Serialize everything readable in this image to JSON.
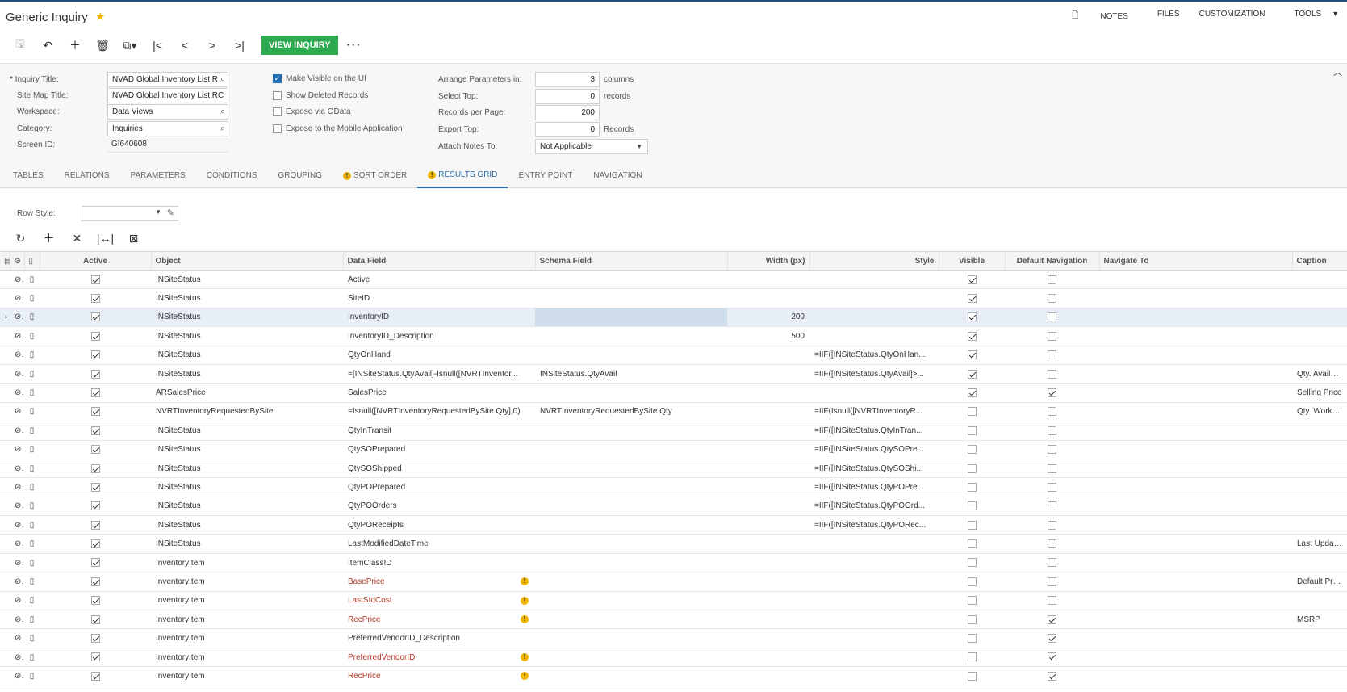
{
  "header": {
    "title": "Generic Inquiry",
    "nav": [
      "NOTES",
      "FILES",
      "CUSTOMIZATION",
      "TOOLS"
    ]
  },
  "toolbar": {
    "view_inquiry": "VIEW INQUIRY",
    "more": "···"
  },
  "form": {
    "inquiry_title_label": "Inquiry Title:",
    "inquiry_title": "NVAD Global Inventory List R",
    "site_map_title_label": "Site Map Title:",
    "site_map_title": "NVAD Global Inventory List RC",
    "workspace_label": "Workspace:",
    "workspace": "Data Views",
    "category_label": "Category:",
    "category": "Inquiries",
    "screen_id_label": "Screen ID:",
    "screen_id": "GI640608",
    "make_visible": "Make Visible on the UI",
    "show_deleted": "Show Deleted Records",
    "expose_odata": "Expose via OData",
    "expose_mobile": "Expose to the Mobile Application",
    "arrange_label": "Arrange Parameters in:",
    "arrange_value": "3",
    "arrange_unit": "columns",
    "select_top_label": "Select Top:",
    "select_top_value": "0",
    "select_top_unit": "records",
    "records_per_page_label": "Records per Page:",
    "records_per_page_value": "200",
    "export_top_label": "Export Top:",
    "export_top_value": "0",
    "export_top_unit": "Records",
    "attach_notes_label": "Attach Notes To:",
    "attach_notes_value": "Not Applicable"
  },
  "tabs": [
    "TABLES",
    "RELATIONS",
    "PARAMETERS",
    "CONDITIONS",
    "GROUPING",
    "SORT ORDER",
    "RESULTS GRID",
    "ENTRY POINT",
    "NAVIGATION"
  ],
  "row_style_label": "Row Style:",
  "grid": {
    "columns": [
      "Active",
      "Object",
      "Data Field",
      "Schema Field",
      "Width (px)",
      "Style",
      "Visible",
      "Default Navigation",
      "Navigate To",
      "Caption"
    ],
    "rows": [
      {
        "object": "INSiteStatus",
        "field": "Active",
        "schema": "",
        "width": "",
        "style": "",
        "visible": true,
        "defnav": false,
        "caption": ""
      },
      {
        "object": "INSiteStatus",
        "field": "SiteID",
        "schema": "",
        "width": "",
        "style": "",
        "visible": true,
        "defnav": false,
        "caption": ""
      },
      {
        "object": "INSiteStatus",
        "field": "InventoryID",
        "schema": "",
        "width": "200",
        "style": "",
        "visible": true,
        "defnav": false,
        "caption": ""
      },
      {
        "object": "INSiteStatus",
        "field": "InventoryID_Description",
        "schema": "",
        "width": "500",
        "style": "",
        "visible": true,
        "defnav": false,
        "caption": ""
      },
      {
        "object": "INSiteStatus",
        "field": "QtyOnHand",
        "schema": "",
        "width": "",
        "style": "=IIF([INSiteStatus.QtyOnHan...",
        "visible": true,
        "defnav": false,
        "caption": ""
      },
      {
        "object": "INSiteStatus",
        "field": "=[INSiteStatus.QtyAvail]-Isnull([NVRTInventor...",
        "schema": "INSiteStatus.QtyAvail",
        "width": "",
        "style": "=IIF([INSiteStatus.QtyAvail]>...",
        "visible": true,
        "defnav": false,
        "caption": "Qty. Available"
      },
      {
        "object": "ARSalesPrice",
        "field": "SalesPrice",
        "schema": "",
        "width": "",
        "style": "",
        "visible": true,
        "defnav": true,
        "caption": "Selling Price"
      },
      {
        "object": "NVRTInventoryRequestedBySite",
        "field": "=Isnull([NVRTInventoryRequestedBySite.Qty],0)",
        "schema": "NVRTInventoryRequestedBySite.Qty",
        "width": "",
        "style": "=IIF(Isnull([NVRTInventoryR...",
        "visible": false,
        "defnav": false,
        "caption": "Qty. Work Order"
      },
      {
        "object": "INSiteStatus",
        "field": "QtyInTransit",
        "schema": "",
        "width": "",
        "style": "=IIF([INSiteStatus.QtyInTran...",
        "visible": false,
        "defnav": false,
        "caption": ""
      },
      {
        "object": "INSiteStatus",
        "field": "QtySOPrepared",
        "schema": "",
        "width": "",
        "style": "=IIF([INSiteStatus.QtySOPre...",
        "visible": false,
        "defnav": false,
        "caption": ""
      },
      {
        "object": "INSiteStatus",
        "field": "QtySOShipped",
        "schema": "",
        "width": "",
        "style": "=IIF([INSiteStatus.QtySOShi...",
        "visible": false,
        "defnav": false,
        "caption": ""
      },
      {
        "object": "INSiteStatus",
        "field": "QtyPOPrepared",
        "schema": "",
        "width": "",
        "style": "=IIF([INSiteStatus.QtyPOPre...",
        "visible": false,
        "defnav": false,
        "caption": ""
      },
      {
        "object": "INSiteStatus",
        "field": "QtyPOOrders",
        "schema": "",
        "width": "",
        "style": "=IIF([INSiteStatus.QtyPOOrd...",
        "visible": false,
        "defnav": false,
        "caption": ""
      },
      {
        "object": "INSiteStatus",
        "field": "QtyPOReceipts",
        "schema": "",
        "width": "",
        "style": "=IIF([INSiteStatus.QtyPORec...",
        "visible": false,
        "defnav": false,
        "caption": ""
      },
      {
        "object": "INSiteStatus",
        "field": "LastModifiedDateTime",
        "schema": "",
        "width": "",
        "style": "",
        "visible": false,
        "defnav": false,
        "caption": "Last Updated"
      },
      {
        "object": "InventoryItem",
        "field": "ItemClassID",
        "schema": "",
        "width": "",
        "style": "",
        "visible": false,
        "defnav": false,
        "caption": ""
      },
      {
        "object": "InventoryItem",
        "field": "BasePrice",
        "schema": "",
        "width": "",
        "style": "",
        "visible": false,
        "defnav": false,
        "caption": "Default Price",
        "warn": true
      },
      {
        "object": "InventoryItem",
        "field": "LastStdCost",
        "schema": "",
        "width": "",
        "style": "",
        "visible": false,
        "defnav": false,
        "caption": "",
        "warn": true
      },
      {
        "object": "InventoryItem",
        "field": "RecPrice",
        "schema": "",
        "width": "",
        "style": "",
        "visible": false,
        "defnav": true,
        "caption": "MSRP",
        "warn": true
      },
      {
        "object": "InventoryItem",
        "field": "PreferredVendorID_Description",
        "schema": "",
        "width": "",
        "style": "",
        "visible": false,
        "defnav": true,
        "caption": ""
      },
      {
        "object": "InventoryItem",
        "field": "PreferredVendorID",
        "schema": "",
        "width": "",
        "style": "",
        "visible": false,
        "defnav": true,
        "caption": "",
        "warn": true
      },
      {
        "object": "InventoryItem",
        "field": "RecPrice",
        "schema": "",
        "width": "",
        "style": "",
        "visible": false,
        "defnav": true,
        "caption": "",
        "warn": true
      }
    ]
  }
}
